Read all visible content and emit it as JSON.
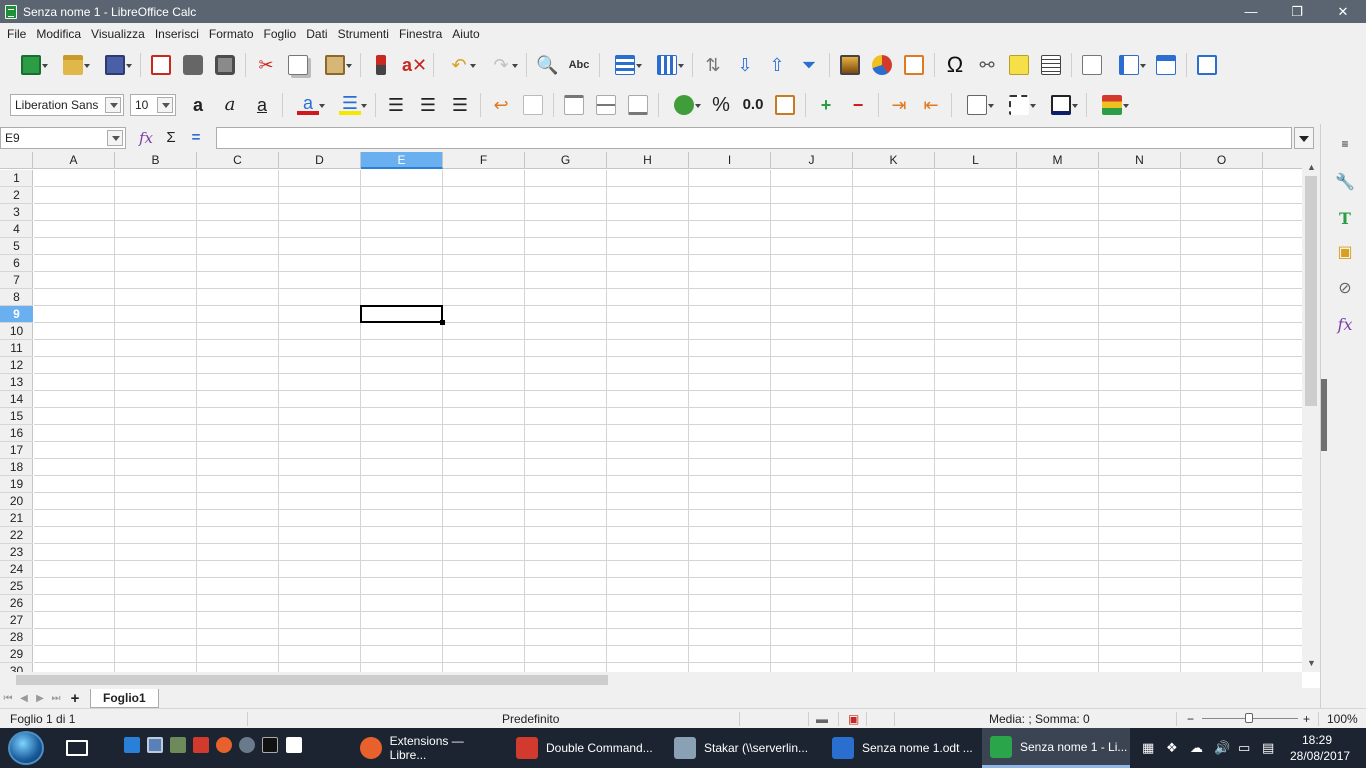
{
  "window": {
    "title": "Senza nome 1 - LibreOffice Calc",
    "minimize": "—",
    "maximize": "❐",
    "close": "✕"
  },
  "menu": [
    "File",
    "Modifica",
    "Visualizza",
    "Inserisci",
    "Formato",
    "Foglio",
    "Dati",
    "Strumenti",
    "Finestra",
    "Aiuto"
  ],
  "formatting": {
    "font_name": "Liberation Sans",
    "font_size": "10",
    "percent": "%",
    "decimal": "0.0"
  },
  "formula_bar": {
    "name_box": "E9",
    "function_wizard": "fx",
    "sum": "Σ",
    "equals": "=",
    "input": ""
  },
  "grid": {
    "columns": [
      "A",
      "B",
      "C",
      "D",
      "E",
      "F",
      "G",
      "H",
      "I",
      "J",
      "K",
      "L",
      "M",
      "N",
      "O"
    ],
    "rows": [
      "1",
      "2",
      "3",
      "4",
      "5",
      "6",
      "7",
      "8",
      "9",
      "10",
      "11",
      "12",
      "13",
      "14",
      "15",
      "16",
      "17",
      "18",
      "19",
      "20",
      "21",
      "22",
      "23",
      "24",
      "25",
      "26",
      "27",
      "28",
      "29",
      "30"
    ],
    "selected_column": "E",
    "selected_row": "9"
  },
  "sheets": {
    "add": "+",
    "tabs": [
      "Foglio1"
    ]
  },
  "status": {
    "sheet_info": "Foglio 1 di 1",
    "page_style": "Predefinito",
    "stats": "Media: ; Somma: 0",
    "zoom_minus": "−",
    "zoom_plus": "+",
    "zoom": "100%"
  },
  "taskbar": {
    "items": [
      {
        "label": "Extensions — Libre...",
        "color": "#e8612c"
      },
      {
        "label": "Double Command...",
        "color": "#d23a2e"
      },
      {
        "label": "Stakar (\\\\serverlin...",
        "color": "#8aa0b4"
      },
      {
        "label": "Senza nome 1.odt ...",
        "color": "#2a6fd0"
      },
      {
        "label": "Senza nome 1 - Li...",
        "color": "#2aa54a"
      }
    ],
    "time": "18:29",
    "date": "28/08/2017"
  },
  "colors": {
    "accent": "#6ab0f0",
    "titlebar": "#5b6571",
    "taskbar": "#1b2430"
  }
}
